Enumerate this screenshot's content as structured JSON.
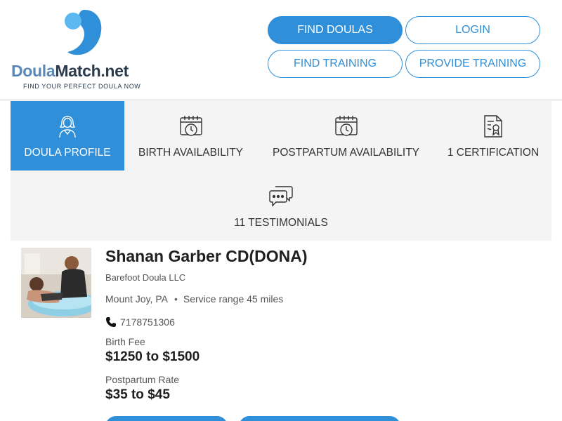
{
  "brand": {
    "name_part1": "Doula",
    "name_part2": "Match.net",
    "tagline": "FIND YOUR PERFECT DOULA NOW",
    "colors": {
      "primary": "#2f8fd8",
      "light": "#5bb8f0",
      "dark": "#2a3b4c"
    }
  },
  "nav": {
    "find_doulas": "FIND DOULAS",
    "login": "LOGIN",
    "find_training": "FIND TRAINING",
    "provide_training": "PROVIDE TRAINING"
  },
  "tabs": [
    {
      "label": "DOULA PROFILE",
      "icon": "doula-person-icon",
      "active": true
    },
    {
      "label": "BIRTH AVAILABILITY",
      "icon": "calendar-clock-icon"
    },
    {
      "label": "POSTPARTUM AVAILABILITY",
      "icon": "calendar-clock-icon"
    },
    {
      "label": "1 CERTIFICATION",
      "icon": "certificate-icon"
    },
    {
      "label": "11 TESTIMONIALS",
      "icon": "chat-bubbles-icon"
    }
  ],
  "profile": {
    "name": "Shanan Garber CD(DONA)",
    "business": "Barefoot Doula LLC",
    "location": "Mount Joy, PA",
    "service_range": "Service range 45 miles",
    "phone": "7178751306",
    "birth_fee_label": "Birth Fee",
    "birth_fee": "$1250 to $1500",
    "postpartum_label": "Postpartum Rate",
    "postpartum_rate": "$35 to $45"
  }
}
